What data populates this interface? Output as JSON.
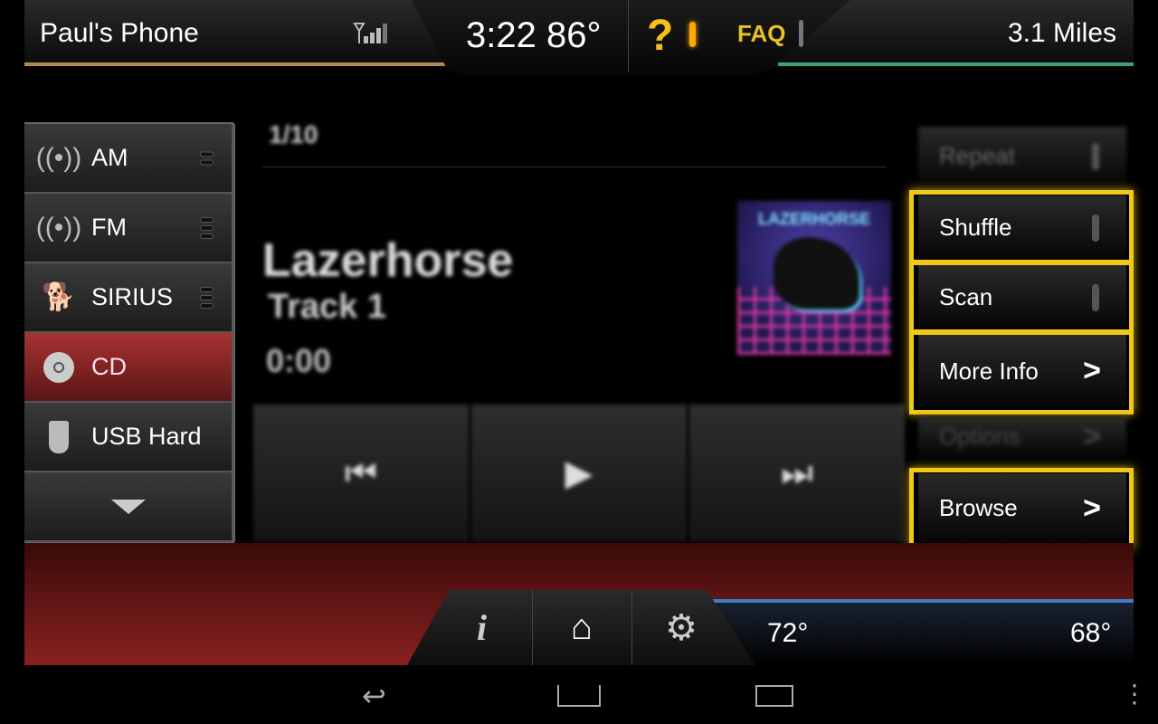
{
  "status": {
    "device_name": "Paul's Phone",
    "clock_temp": "3:22 86°",
    "help": "?",
    "faq": "FAQ",
    "distance": "3.1 Miles",
    "signal_icon": "signal-icon"
  },
  "sources": [
    {
      "label": "AM",
      "icon": "radio-antenna-icon"
    },
    {
      "label": "FM",
      "icon": "radio-antenna-icon"
    },
    {
      "label": "SIRIUS",
      "icon": "sirius-dog-icon"
    },
    {
      "label": "CD",
      "icon": "disc-icon",
      "active": true
    },
    {
      "label": "USB Hard",
      "icon": "usb-icon"
    }
  ],
  "player": {
    "track_position": "1/10",
    "album": "Lazerhorse",
    "track": "Track 1",
    "time": "0:00",
    "album_art_text": "LAZERHORSE"
  },
  "options": {
    "repeat": "Repeat",
    "shuffle": "Shuffle",
    "scan": "Scan",
    "more_info": "More Info",
    "options": "Options",
    "browse": "Browse"
  },
  "climate": {
    "left_temp": "72°",
    "right_temp": "68°"
  },
  "colors": {
    "highlight": "#f0c818",
    "active_source": "#a83232",
    "accent_blue": "#3c7fc8"
  }
}
